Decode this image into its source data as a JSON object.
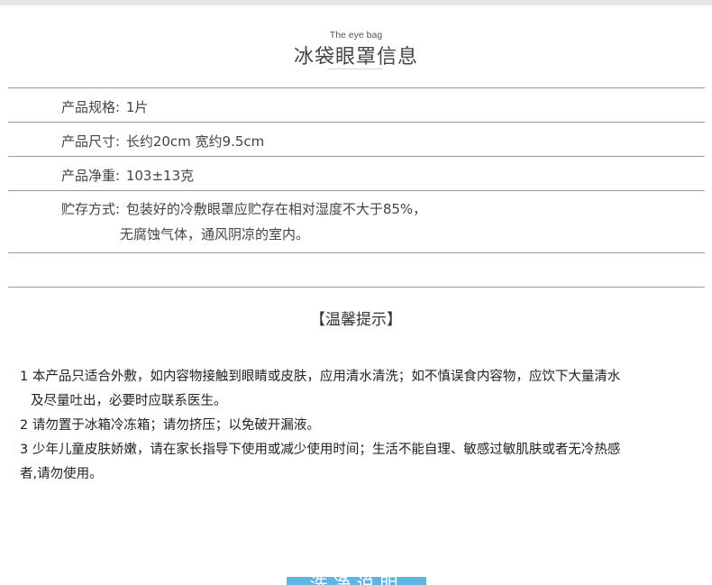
{
  "header": {
    "subtitle_en": "The eye bag",
    "title_cn": "冰袋眼罩信息"
  },
  "specs": [
    {
      "label": "产品规格:",
      "value": "1片"
    },
    {
      "label": "产品尺寸:",
      "value": "长约20cm 宽约9.5cm"
    },
    {
      "label": "产品净重:",
      "value": "103±13克"
    }
  ],
  "storage": {
    "label": "贮存方式:",
    "line1": "包装好的冷敷眼罩应贮存在相对湿度不大于85%，",
    "line2": "无腐蚀气体，通风阴凉的室内。"
  },
  "tips": {
    "title": "【温馨提示】",
    "lines": [
      "1 本产品只适合外敷，如内容物接触到眼睛或皮肤，应用清水清洗；如不慎误食内容物，应饮下大量清水",
      "及尽量吐出，必要时应联系医生。",
      "2 请勿置于冰箱冷冻箱；请勿挤压；以免破开漏液。",
      "3 少年儿童皮肤娇嫩，请在家长指导下使用或减少使用时间；生活不能自理、敏感过敏肌肤或者无冷热感",
      "者,请勿使用。"
    ]
  },
  "footer": {
    "bar_label": "洗净说明",
    "bar_color": "#5fb4e2"
  }
}
